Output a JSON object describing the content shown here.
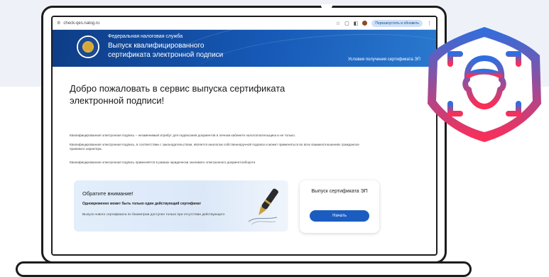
{
  "browser": {
    "url": "check-qes.nalog.ru",
    "relaunch_label": "Перезапустить и обновить"
  },
  "header": {
    "org": "Федеральная налоговая служба",
    "title_line1": "Выпуск квалифицированного",
    "title_line2": "сертификата электронной подписи",
    "conditions_link": "Условия получения сертификата ЭП"
  },
  "main": {
    "welcome_line1": "Добро пожаловать в сервис выпуска сертификата",
    "welcome_line2": "электронной подписи!",
    "para1": "Квалифицированная электронная подпись – незаменимый атрибут для подписания документов в личном кабинете налогоплательщика и не только.",
    "para2": "Квалифицированная электронная подпись, в соответствии с законодательством, является аналогом собственноручной подписи и может применяться во всех взаимоотношениях гражданско-правового характера.",
    "para3": "Квалифицированная электронная подпись применяется в рамках юридически значимого электронного документооборота"
  },
  "notice": {
    "title": "Обратите внимание!",
    "line1": "Одновременно может быть только один действующий сертификат",
    "line2": "Выпуск нового сертификата по биометрии доступен только при отсутствии действующего"
  },
  "card": {
    "title": "Выпуск сертификата ЭП",
    "button": "Начать"
  },
  "colors": {
    "header_blue": "#1659b6",
    "button_blue": "#1b5cc0",
    "badge_gradient_top": "#2d6fe0",
    "badge_gradient_bottom": "#ff2d55"
  },
  "icons": [
    "site-info-icon",
    "star-icon",
    "extensions-icon",
    "sidepanel-icon",
    "avatar",
    "menu-icon",
    "fns-emblem-icon",
    "fountain-pen-icon",
    "face-id-icon"
  ]
}
